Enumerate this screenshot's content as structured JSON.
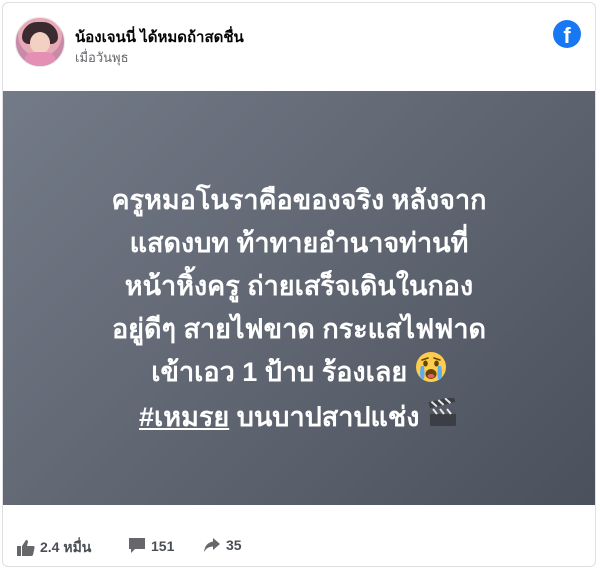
{
  "post": {
    "author": "น้องเจนนี่ ได้หมดถ้าสดชื่น",
    "timestamp": "เมื่อวันพุธ",
    "lines": [
      "ครูหมอโนราคือของจริง หลังจาก",
      "แสดงบท ท้าทายอำนาจท่านที่",
      "หน้าหิ้งครู ถ่ายเสร็จเดินในกอง",
      "อยู่ดีๆ สายไฟขาด กระแสไฟฟาด",
      "เข้าเอว 1 ป้าบ ร้องเลย"
    ],
    "hashtag": "#เหมรย",
    "last_line_rest": " บนบาปสาปแช่ง",
    "emojis": [
      "crying-face-icon",
      "clapper-board-icon"
    ],
    "background_colors": [
      "#747b88",
      "#4b515c"
    ]
  },
  "brand": {
    "logo_letter": "f",
    "color": "#1877f2"
  },
  "stats": {
    "likes": "2.4 หมื่น",
    "comments": "151",
    "shares": "35"
  }
}
